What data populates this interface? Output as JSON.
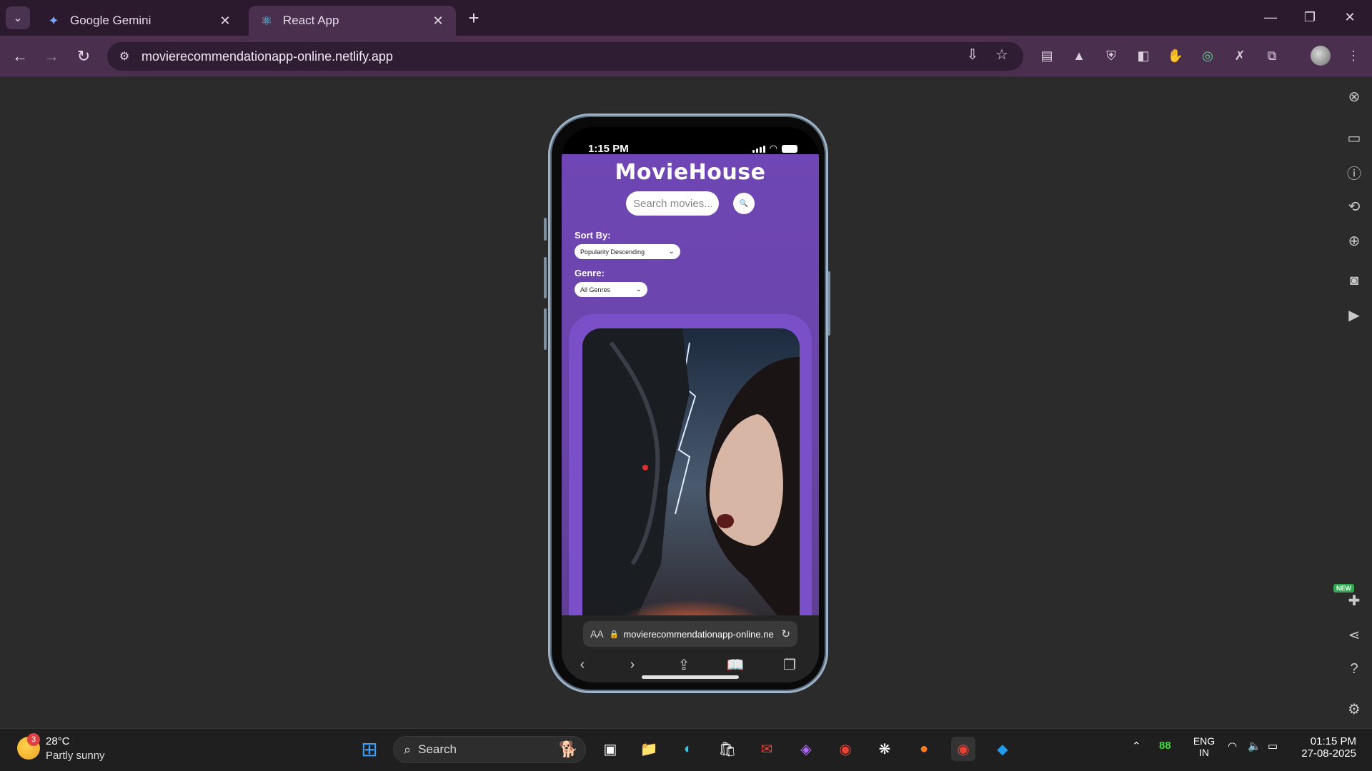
{
  "browser": {
    "tabs": [
      {
        "title": "Google Gemini",
        "icon": "gemini-icon"
      },
      {
        "title": "React App",
        "icon": "react-icon"
      }
    ],
    "url": "movierecommendationapp-online.netlify.app"
  },
  "phone": {
    "time": "1:15 PM",
    "app": {
      "logo": "MovieHouse",
      "search_placeholder": "Search movies...",
      "sort_label": "Sort By:",
      "sort_value": "Popularity Descending",
      "genre_label": "Genre:",
      "genre_value": "All Genres"
    },
    "safari": {
      "aa": "AA",
      "url": "movierecommendationapp-online.ne"
    }
  },
  "taskbar": {
    "weather_badge": "3",
    "temperature": "28°C",
    "weather": "Partly sunny",
    "search": "Search",
    "battery_number": "88",
    "lang_top": "ENG",
    "lang_bottom": "IN",
    "time": "01:15 PM",
    "date": "27-08-2025"
  },
  "colors": {
    "app_purple": "#6f46b5",
    "card_purple": "#7a4fc7",
    "browser_frame": "#4a2f4f"
  }
}
